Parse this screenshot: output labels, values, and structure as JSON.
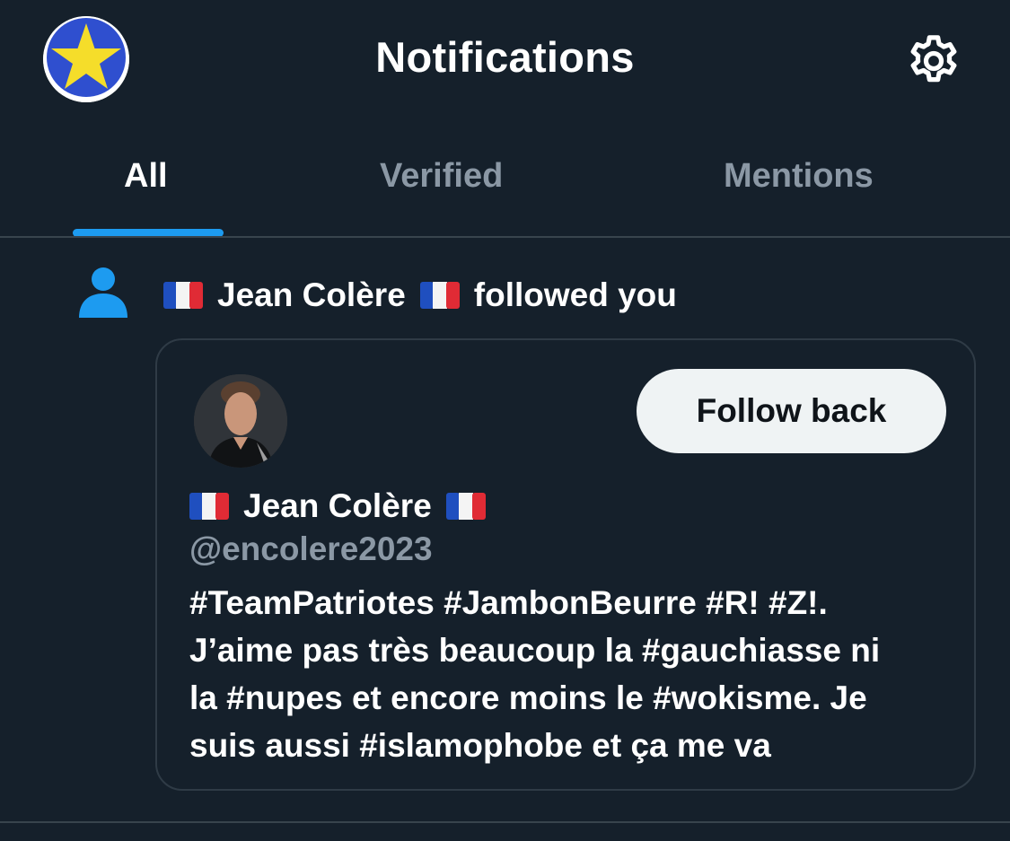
{
  "header": {
    "title": "Notifications",
    "profile_icon": "star-avatar",
    "settings_icon": "gear-icon"
  },
  "tabs": [
    {
      "label": "All",
      "active": true
    },
    {
      "label": "Verified",
      "active": false
    },
    {
      "label": "Mentions",
      "active": false
    }
  ],
  "notification": {
    "icon": "person-icon",
    "actor_name": "Jean Colère",
    "action": "followed you"
  },
  "card": {
    "name": "Jean Colère",
    "handle": "@encolere2023",
    "follow_button": "Follow back",
    "bio_lines": [
      "#TeamPatriotes #JambonBeurre #R! #Z!.",
      "J’aime pas très beaucoup la #gauchiasse ni",
      "la #nupes et encore moins le #wokisme. Je",
      "suis aussi #islamophobe et ça me va"
    ]
  },
  "colors": {
    "background": "#15202b",
    "accent": "#1d9bf0",
    "muted_text": "#8b98a5",
    "button_bg": "#eff3f4"
  }
}
